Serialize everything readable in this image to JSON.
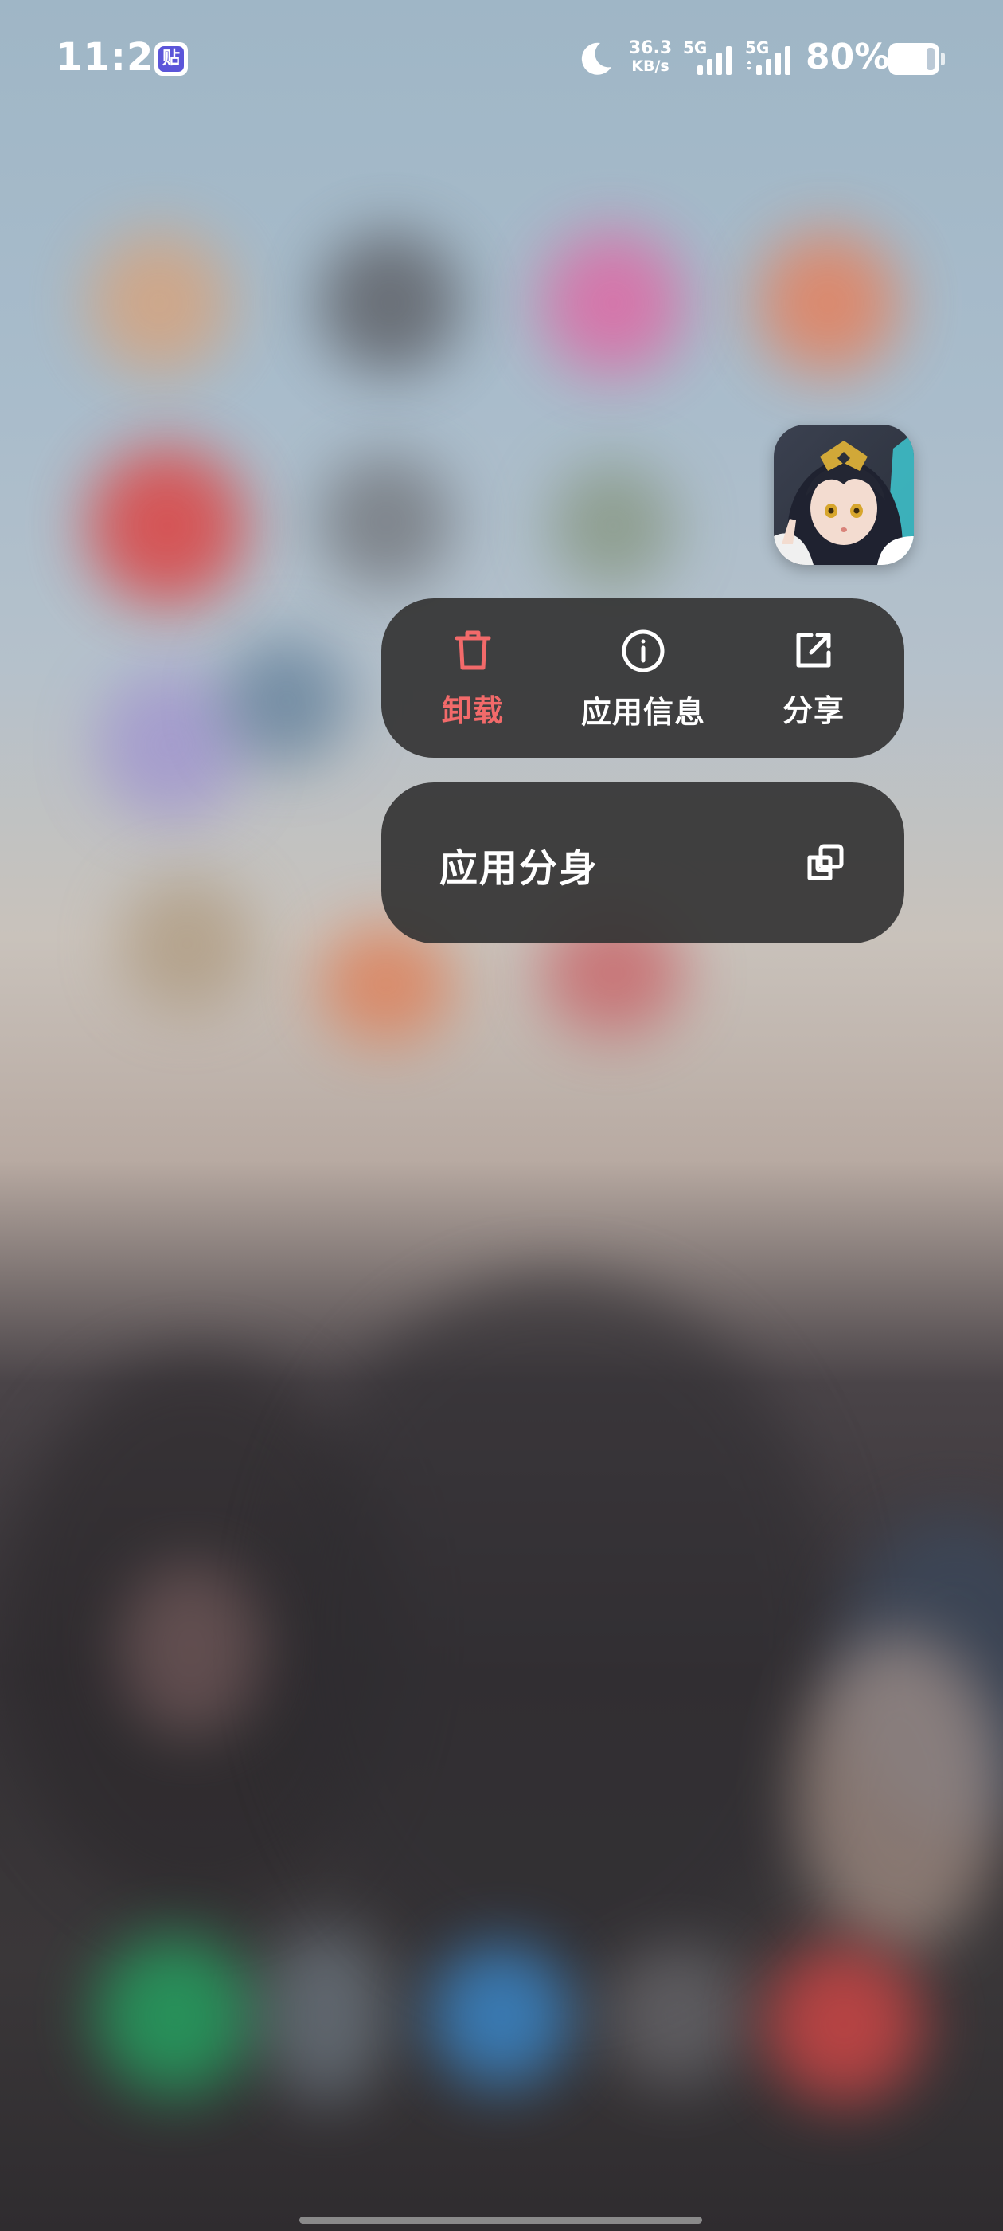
{
  "status_bar": {
    "time": "11:21",
    "sticker_badge": "贴",
    "net_speed_value": "36.3",
    "net_speed_unit": "KB/s",
    "sim1_label": "5G",
    "sim2_label": "5G",
    "battery_percent": "80%",
    "battery_level": 0.8,
    "icons": [
      "moon-icon",
      "signal-icon",
      "battery-icon"
    ]
  },
  "app_menu": {
    "actions": [
      {
        "label": "卸载",
        "icon": "trash-icon",
        "color": "#f26a6a"
      },
      {
        "label": "应用信息",
        "icon": "info-icon",
        "color": "#ffffff"
      },
      {
        "label": "分享",
        "icon": "share-icon",
        "color": "#ffffff"
      }
    ],
    "clone": {
      "label": "应用分身",
      "icon": "clone-icon"
    }
  },
  "colors": {
    "menu_background": "#343434",
    "destructive": "#f26a6a",
    "text": "#ffffff"
  }
}
